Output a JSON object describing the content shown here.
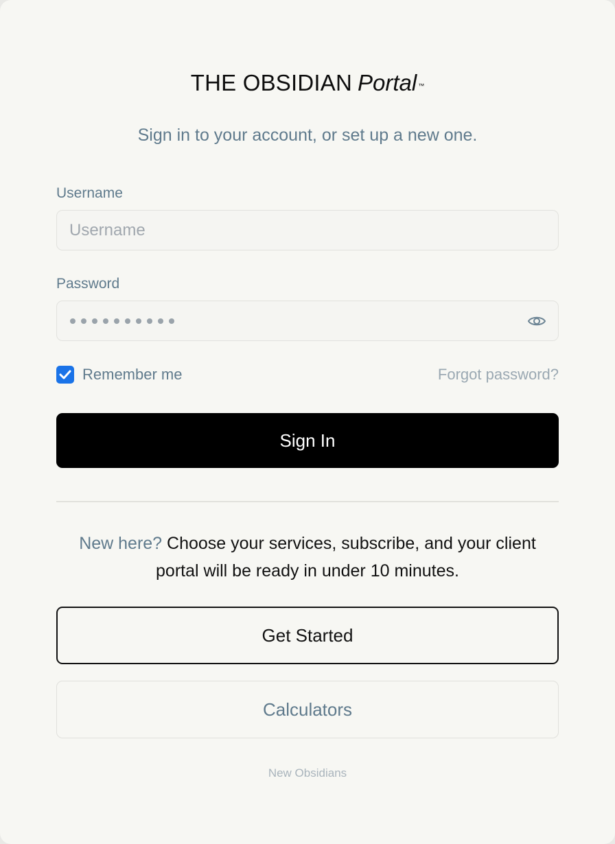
{
  "brand": {
    "name": "THE OBSIDIAN",
    "product": "Portal",
    "trademark": "™"
  },
  "subtitle": "Sign in to your account, or set up a new one.",
  "username": {
    "label": "Username",
    "placeholder": "Username",
    "value": ""
  },
  "password": {
    "label": "Password",
    "masked_length": 10,
    "toggle_icon": "eye-icon"
  },
  "remember": {
    "label": "Remember me",
    "checked": true,
    "color": "#1a73e8"
  },
  "forgot_label": "Forgot password?",
  "signin_label": "Sign In",
  "promo": {
    "accent": "New here?",
    "text": " Choose your services, subscribe, and your client portal will be ready in under 10 minutes."
  },
  "get_started_label": "Get Started",
  "calculators_label": "Calculators",
  "footer_text": "New Obsidians",
  "colors": {
    "accent_text": "#5f7a8c",
    "primary_button": "#000000",
    "background": "#f7f7f3"
  }
}
